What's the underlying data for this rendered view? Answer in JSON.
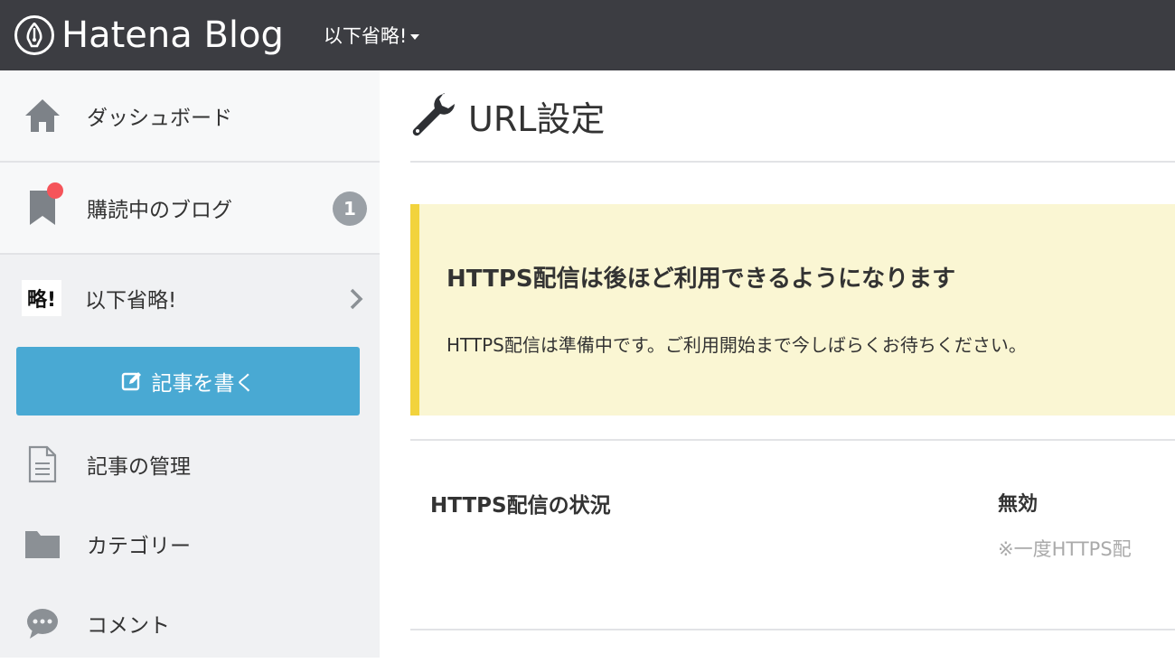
{
  "header": {
    "logo_text": "Hatena Blog",
    "blog_name": "以下省略!",
    "bg_color": "#3c3d42"
  },
  "sidebar": {
    "dashboard_label": "ダッシュボード",
    "subscribed_label": "購読中のブログ",
    "subscribed_count": "1",
    "blog_icon_text": "略!",
    "blog_label": "以下省略!",
    "write_label": "記事を書く",
    "menu": [
      {
        "label": "記事の管理",
        "icon": "document-icon"
      },
      {
        "label": "カテゴリー",
        "icon": "folder-icon"
      },
      {
        "label": "コメント",
        "icon": "comment-icon"
      }
    ],
    "accent_color": "#49a9d3"
  },
  "main": {
    "page_title": "URL設定",
    "notice": {
      "title": "HTTPS配信は後ほど利用できるようになります",
      "text": "HTTPS配信は準備中です。ご利用開始まで今しばらくお待ちください。"
    },
    "https_status": {
      "label": "HTTPS配信の状況",
      "value": "無効",
      "note": "※一度HTTPS配"
    }
  }
}
